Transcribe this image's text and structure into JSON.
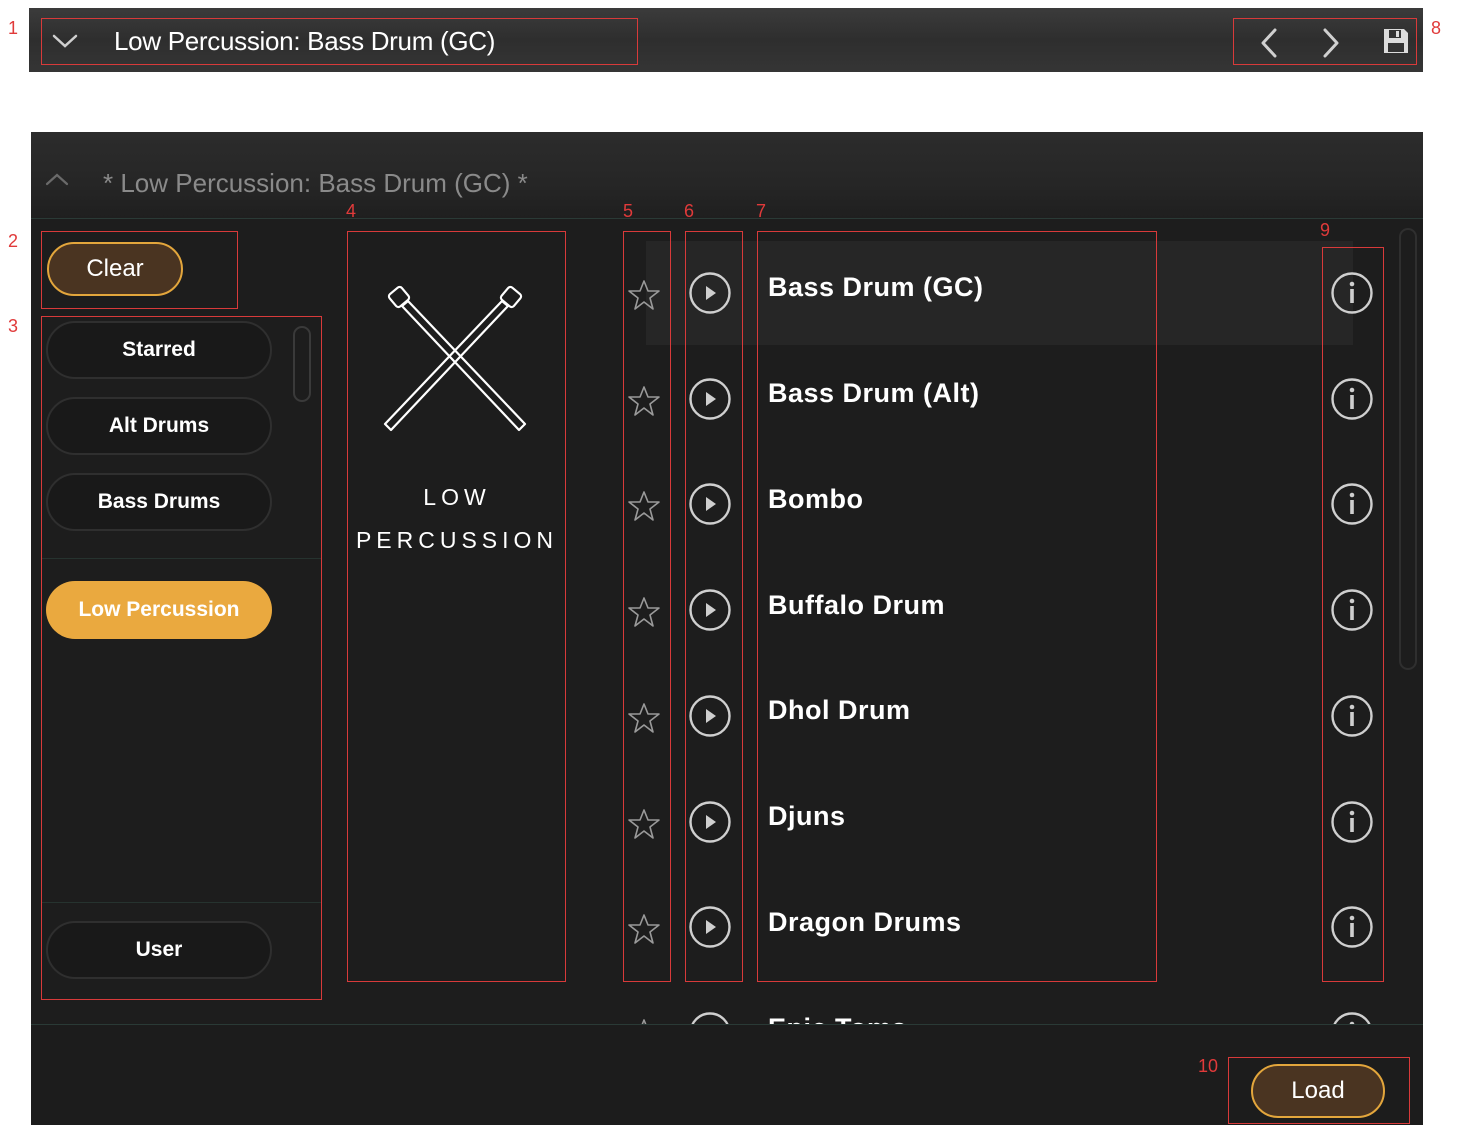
{
  "topbar": {
    "title": "Low Percussion: Bass Drum (GC)",
    "icons": [
      "chevron-down-icon",
      "chevron-left-icon",
      "chevron-right-icon",
      "save-icon"
    ]
  },
  "browser": {
    "title": "* Low Percussion: Bass Drum (GC) *",
    "clear_label": "Clear",
    "load_label": "Load",
    "categories": [
      "Starred",
      "Alt Drums",
      "Bass Drums"
    ],
    "active_category": "Low Percussion",
    "user_label": "User",
    "tile": {
      "line1": "LOW",
      "line2": "PERCUSSION"
    },
    "instruments": [
      "Bass Drum (GC)",
      "Bass Drum (Alt)",
      "Bombo",
      "Buffalo Drum",
      "Dhol Drum",
      "Djuns",
      "Dragon Drums",
      "Epic Toms"
    ],
    "selected_instrument": "Bass Drum (GC)"
  },
  "annotations": [
    "1",
    "2",
    "3",
    "4",
    "5",
    "6",
    "7",
    "8",
    "9",
    "10"
  ],
  "colors": {
    "accent": "#eaa93f",
    "button_fill": "#4a3421",
    "panel_bg": "#1d1d1d",
    "annotation": "#e03a3a"
  }
}
